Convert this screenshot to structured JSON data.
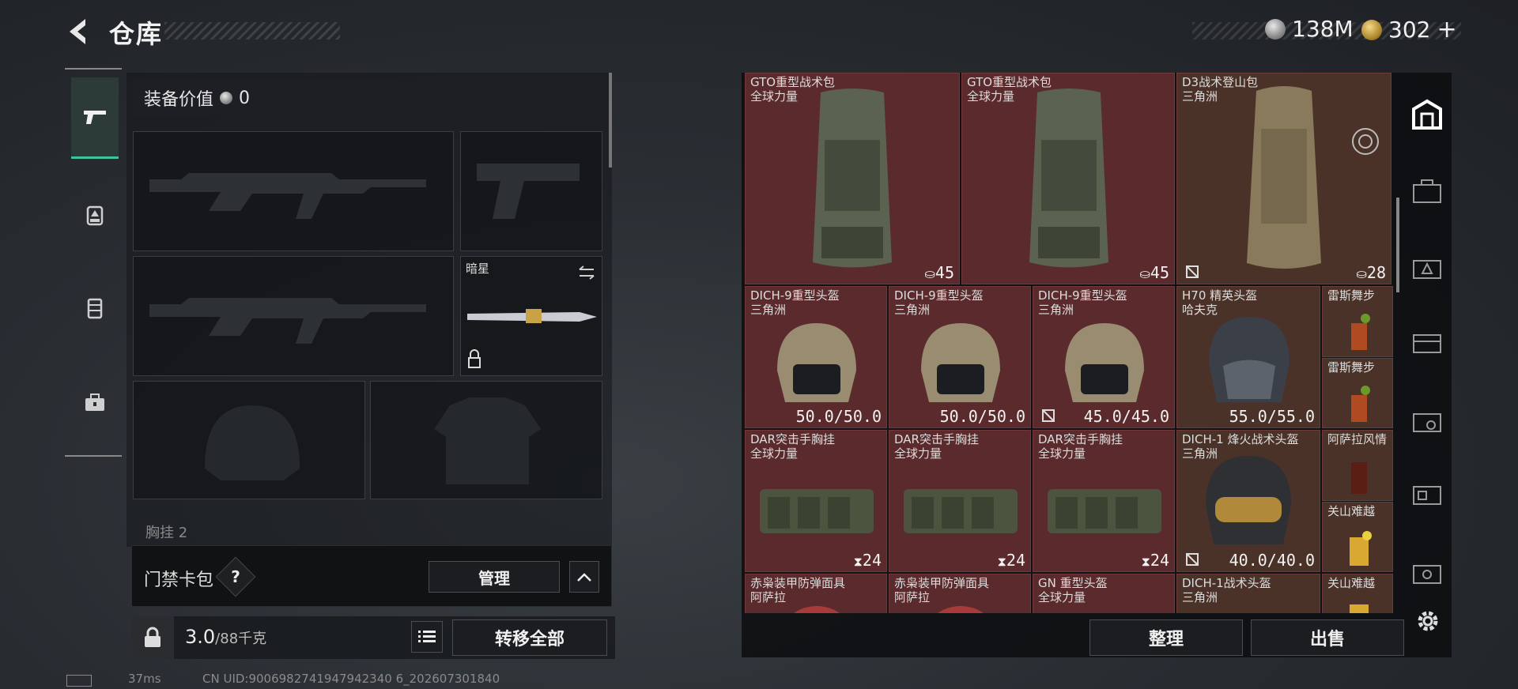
{
  "header": {
    "title": "仓库"
  },
  "currency": {
    "silver": "138M",
    "gold": "302",
    "gold_plus": "+"
  },
  "equipment": {
    "value_label": "装备价值",
    "value": "0",
    "melee_name": "暗星",
    "chest_label": "胸挂",
    "chest_count": "2"
  },
  "access_card": {
    "title": "门禁卡包",
    "help": "?",
    "manage": "管理"
  },
  "bottom": {
    "weight_value": "3.0",
    "weight_max": "/88千克",
    "transfer_all": "转移全部"
  },
  "status": {
    "ping": "37ms",
    "uid": "CN UID:9006982741947942340 6_202607301840"
  },
  "inventory": {
    "sort": "整理",
    "sell": "出售",
    "row1": [
      {
        "name": "GTO重型战术包",
        "sub": "全球力量",
        "value": "45"
      },
      {
        "name": "GTO重型战术包",
        "sub": "全球力量",
        "value": "45"
      },
      {
        "name": "D3战术登山包",
        "sub": "三角洲",
        "value": "28"
      }
    ],
    "row2": [
      {
        "name": "DICH-9重型头盔",
        "sub": "三角洲",
        "value": "50.0/50.0"
      },
      {
        "name": "DICH-9重型头盔",
        "sub": "三角洲",
        "value": "50.0/50.0"
      },
      {
        "name": "DICH-9重型头盔",
        "sub": "三角洲",
        "value": "45.0/45.0"
      },
      {
        "name": "H70 精英头盔",
        "sub": "哈夫克",
        "value": "55.0/55.0"
      }
    ],
    "row3": [
      {
        "name": "DAR突击手胸挂",
        "sub": "全球力量",
        "value": "24"
      },
      {
        "name": "DAR突击手胸挂",
        "sub": "全球力量",
        "value": "24"
      },
      {
        "name": "DAR突击手胸挂",
        "sub": "全球力量",
        "value": "24"
      },
      {
        "name": "DICH-1 烽火战术头盔",
        "sub": "三角洲",
        "value": "40.0/40.0"
      }
    ],
    "row4": [
      {
        "name": "赤枭装甲防弹面具",
        "sub": "阿萨拉"
      },
      {
        "name": "赤枭装甲防弹面具",
        "sub": "阿萨拉"
      },
      {
        "name": "GN 重型头盔",
        "sub": "全球力量"
      },
      {
        "name": "DICH-1战术头盔",
        "sub": "三角洲"
      }
    ],
    "drinks": [
      "雷斯舞步",
      "雷斯舞步",
      "阿萨拉风情",
      "关山难越",
      "关山难越"
    ]
  }
}
